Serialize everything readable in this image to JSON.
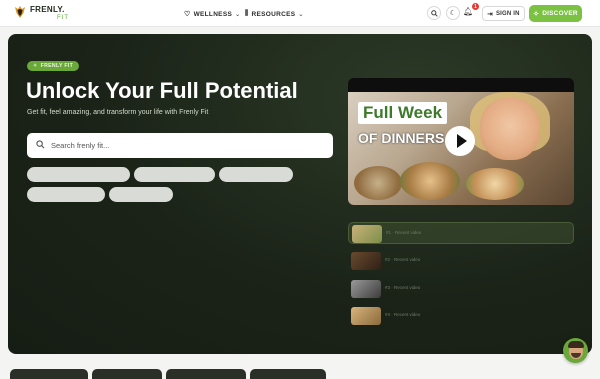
{
  "brand": {
    "name": "FRENLY.",
    "sub": "FIT",
    "accent": "#7bc142",
    "dark": "#1b2318"
  },
  "nav": {
    "wellness": "WELLNESS",
    "resources": "RESOURCES",
    "notification_count": "1",
    "sign_in": "SIGN IN",
    "discover": "DISCOVER",
    "icons": [
      "heart-icon",
      "books-icon",
      "search-icon",
      "moon-icon",
      "bell-icon",
      "login-icon",
      "sparkle-icon"
    ]
  },
  "hero": {
    "pill": "FRENLY FIT",
    "title": "Unlock Your Full Potential",
    "subtitle": "Get fit, feel amazing, and transform your life with Frenly Fit",
    "search_placeholder": "Search frenly fit..."
  },
  "video": {
    "title_line1": "Full Week",
    "title_line2": "OF DINNERS"
  },
  "recent_videos": [
    {
      "label": "#1 · Recent video",
      "active": true
    },
    {
      "label": "#2 · Recent video",
      "active": false
    },
    {
      "label": "#3 · Recent video",
      "active": false
    },
    {
      "label": "#4 · Recent video",
      "active": false
    }
  ]
}
